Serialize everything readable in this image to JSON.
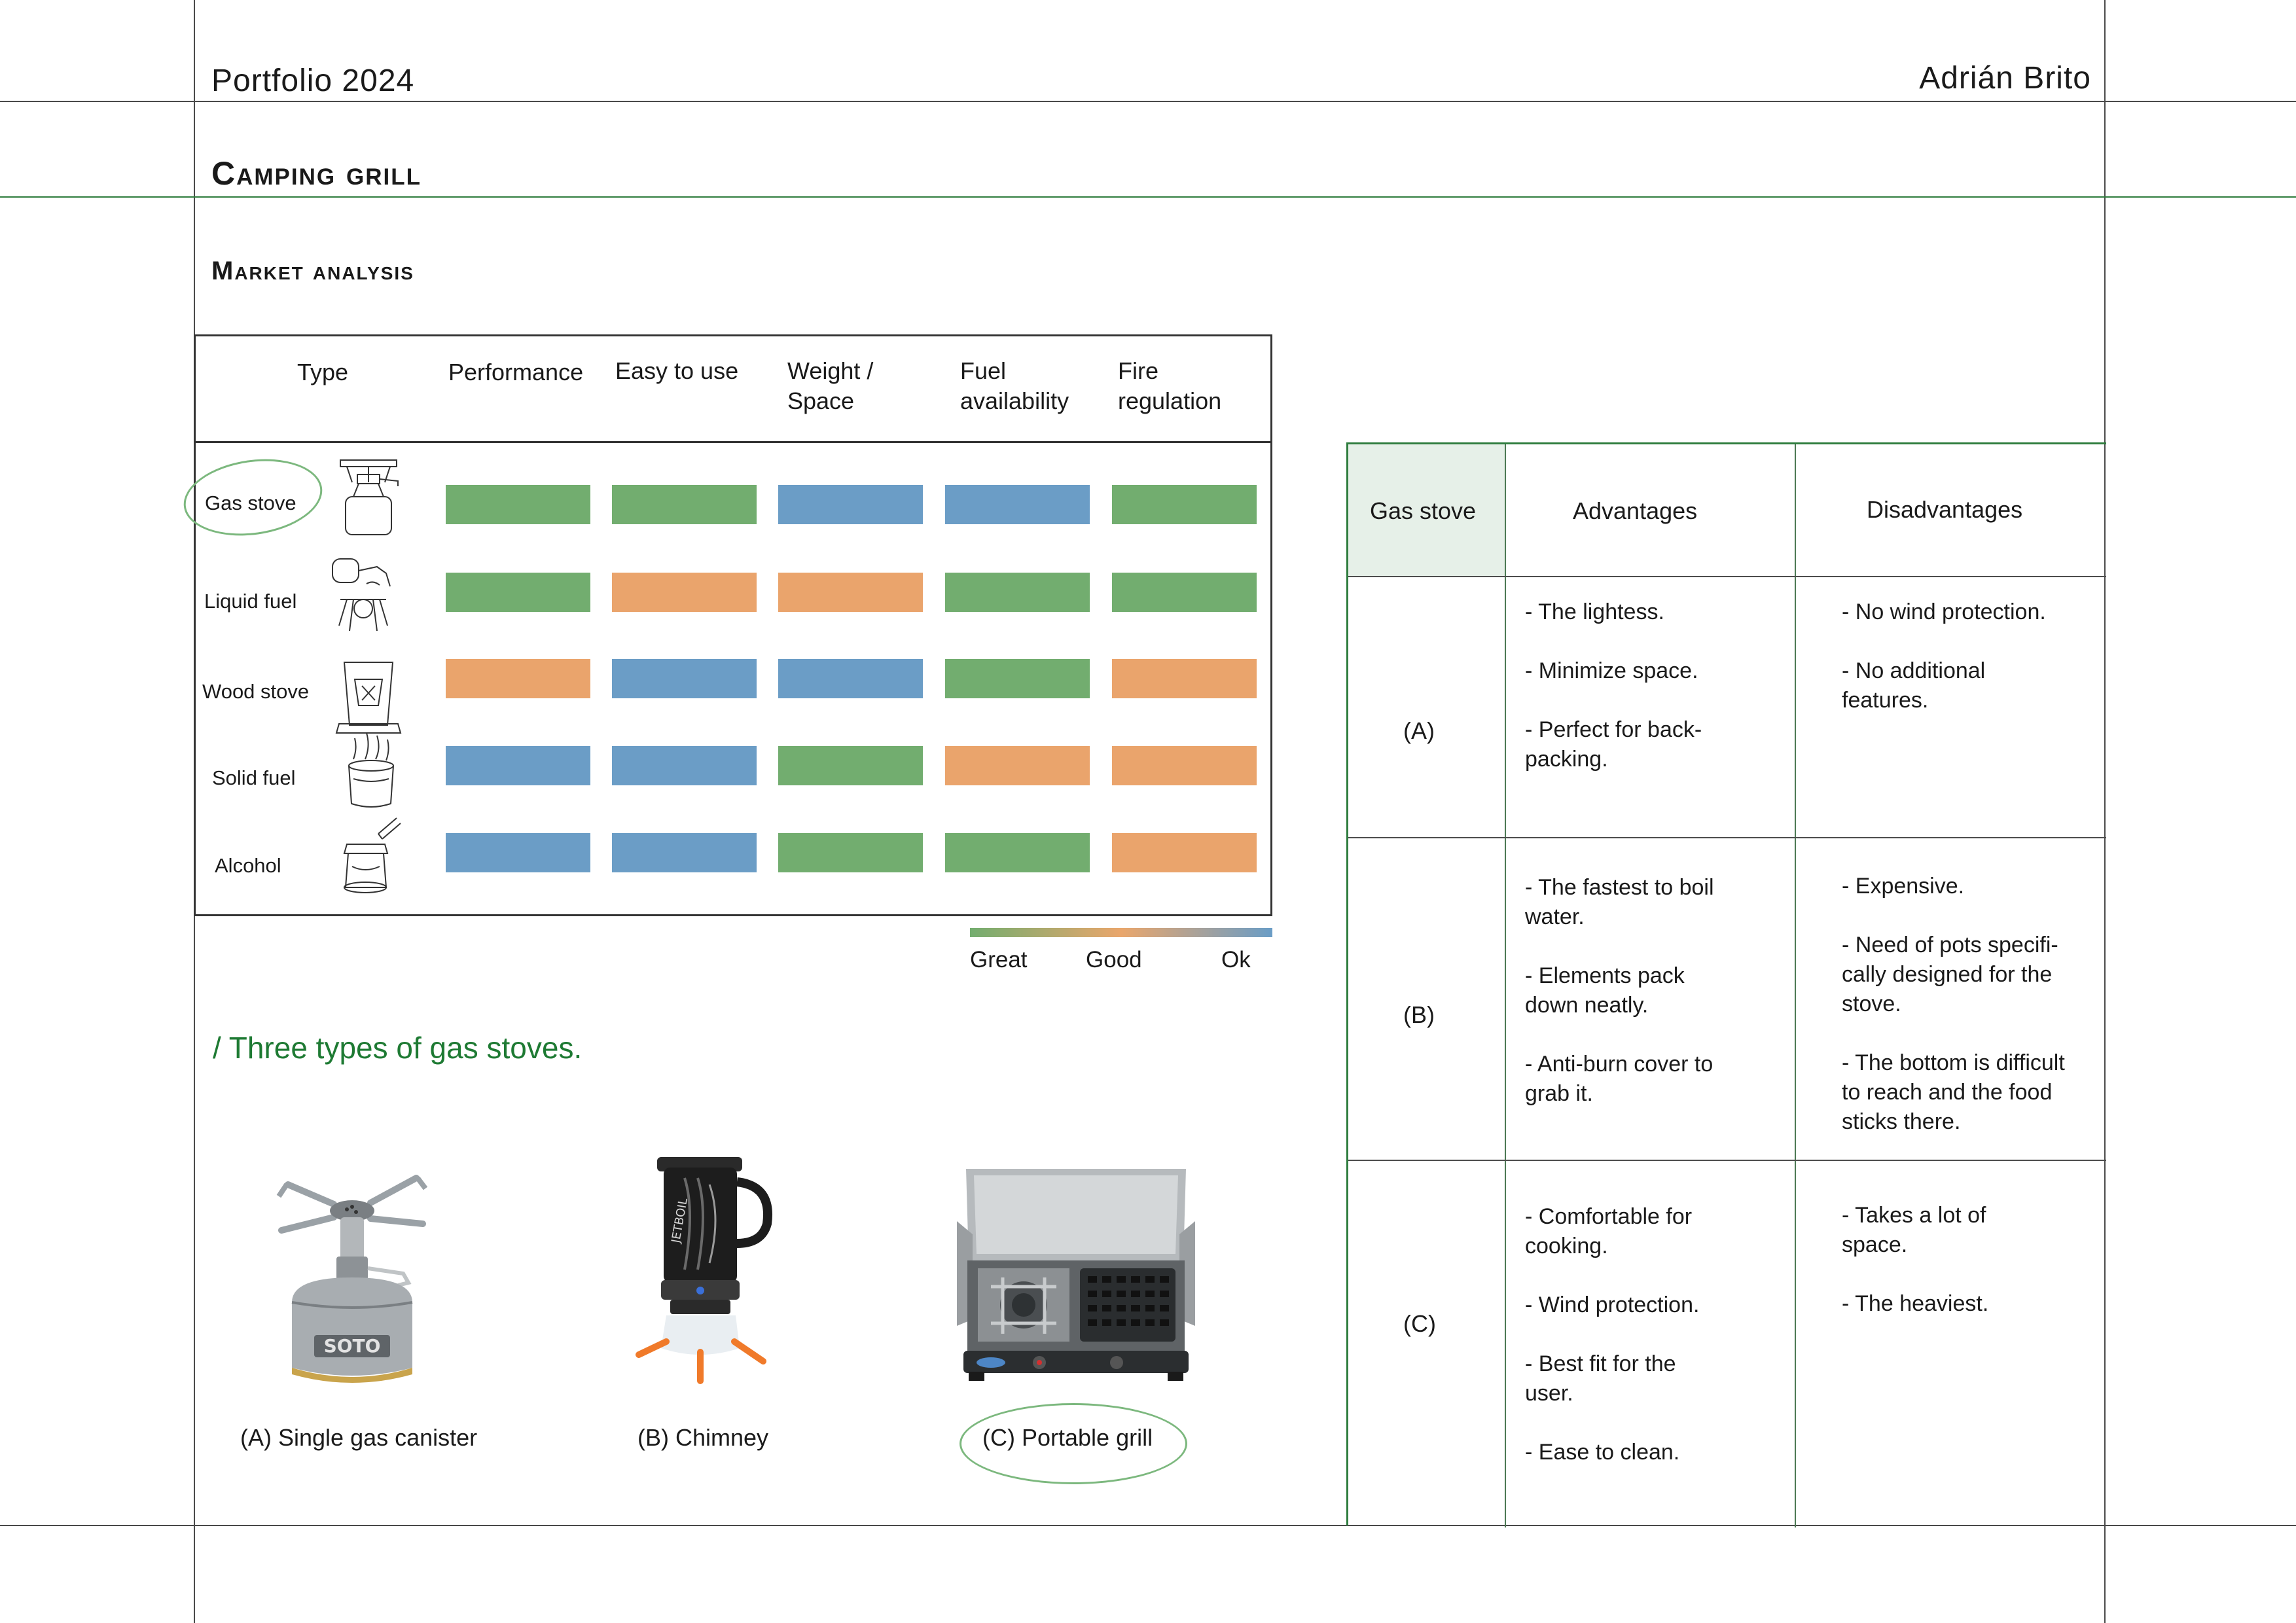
{
  "header": {
    "left": "Portfolio 2024",
    "right": "Adrián Brito"
  },
  "title": "Camping grill",
  "subtitle": "Market analysis",
  "market_table": {
    "columns": [
      "Type",
      "Performance",
      "Easy to use",
      "Weight /\nSpace",
      "Fuel\navailability",
      "Fire\nregulation"
    ],
    "rows": [
      {
        "label": "Gas stove",
        "ratings": [
          "great",
          "great",
          "ok",
          "ok",
          "great"
        ]
      },
      {
        "label": "Liquid fuel",
        "ratings": [
          "great",
          "good",
          "good",
          "great",
          "great"
        ]
      },
      {
        "label": "Wood stove",
        "ratings": [
          "good",
          "ok",
          "ok",
          "great",
          "good"
        ]
      },
      {
        "label": "Solid fuel",
        "ratings": [
          "ok",
          "ok",
          "great",
          "good",
          "good"
        ]
      },
      {
        "label": "Alcohol",
        "ratings": [
          "ok",
          "ok",
          "great",
          "great",
          "good"
        ]
      }
    ]
  },
  "legend": {
    "great": "Great",
    "good": "Good",
    "ok": "Ok"
  },
  "colors": {
    "great": "#72ad6f",
    "good": "#eaa46c",
    "ok": "#6b9dc6",
    "accent_green": "#1e7a33",
    "header_cell": "#e6f0e8"
  },
  "section_heading": "/ Three types of gas stoves.",
  "products": [
    {
      "caption": "(A) Single gas canister"
    },
    {
      "caption": "(B) Chimney"
    },
    {
      "caption": "(C) Portable grill"
    }
  ],
  "comparison": {
    "corner": "Gas stove",
    "advantages_header": "Advantages",
    "disadvantages_header": "Disadvantages",
    "rows": [
      {
        "label": "(A)",
        "advantages": "- The lightess.\n\n- Minimize space.\n\n- Perfect for back-\npacking.",
        "disadvantages": "- No wind protection.\n\n- No additional\nfeatures."
      },
      {
        "label": "(B)",
        "advantages": "- The fastest to boil\nwater.\n\n- Elements pack\ndown neatly.\n\n- Anti-burn cover to\ngrab it.",
        "disadvantages": "- Expensive.\n\n- Need of pots specifi-\ncally designed for the\nstove.\n\n- The bottom is difficult\nto reach and the food\nsticks there."
      },
      {
        "label": "(C)",
        "advantages": "- Comfortable for\ncooking.\n\n- Wind protection.\n\n- Best fit for the\nuser.\n\n- Ease to clean.",
        "disadvantages": "- Takes a lot of\nspace.\n\n- The heaviest."
      }
    ]
  }
}
